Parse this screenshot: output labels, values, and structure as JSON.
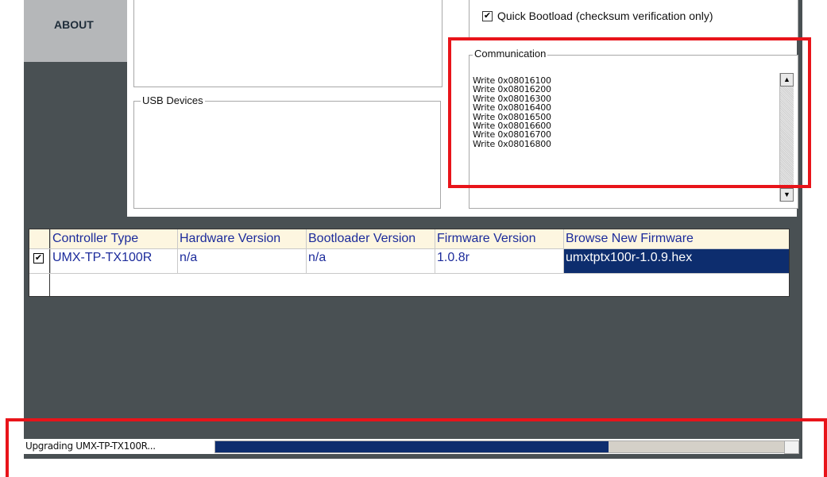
{
  "sidebar": {
    "about_label": "ABOUT"
  },
  "options": {
    "quick_bootload_label": "Quick Bootload (checksum verification only)",
    "quick_bootload_checked": true,
    "check_glyph": "✔"
  },
  "usb_devices": {
    "legend": "USB Devices"
  },
  "communication": {
    "legend": "Communication",
    "log": [
      "Write 0x08016100",
      "Write 0x08016200",
      "Write 0x08016300",
      "Write 0x08016400",
      "Write 0x08016500",
      "Write 0x08016600",
      "Write 0x08016700",
      "Write 0x08016800"
    ],
    "scroll_up_glyph": "▲",
    "scroll_down_glyph": "▼"
  },
  "table": {
    "columns": [
      "Controller Type",
      "Hardware Version",
      "Bootloader Version",
      "Firmware Version",
      "Browse New Firmware"
    ],
    "rows": [
      {
        "checked": true,
        "cells": [
          "UMX-TP-TX100R",
          "n/a",
          "n/a",
          "1.0.8r",
          "umxtptx100r-1.0.9.hex"
        ]
      }
    ],
    "check_glyph": "✔",
    "selected_color": "#0d2d6e"
  },
  "status": {
    "text": "Upgrading UMX-TP-TX100R...",
    "progress": 0.69,
    "bar_color": "#0d2d6e"
  },
  "highlight_color": "#e8141a"
}
